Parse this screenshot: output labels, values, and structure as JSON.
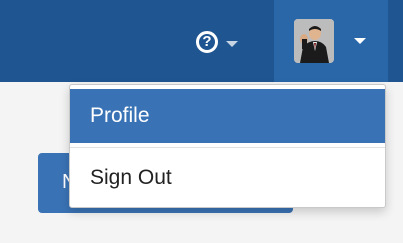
{
  "navbar": {
    "help_symbol": "?",
    "user_menu": {
      "items": [
        {
          "label": "Profile",
          "active": true
        },
        {
          "label": "Sign Out",
          "active": false
        }
      ]
    }
  },
  "background_button": {
    "label": "N"
  },
  "colors": {
    "navbar": "#1f5591",
    "user_toggle": "#2a67a8",
    "accent": "#3a73b5",
    "menu_bg": "#ffffff",
    "page_bg": "#f4f4f4"
  }
}
